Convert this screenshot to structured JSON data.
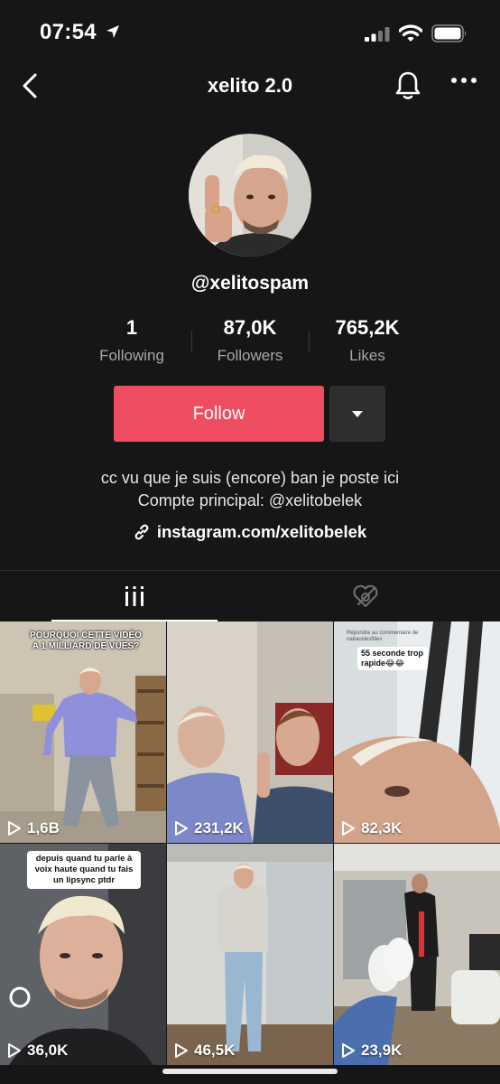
{
  "status_bar": {
    "time": "07:54"
  },
  "header": {
    "title": "xelito 2.0"
  },
  "profile": {
    "username": "@xelitospam",
    "stats": [
      {
        "value": "1",
        "label": "Following"
      },
      {
        "value": "87,0K",
        "label": "Followers"
      },
      {
        "value": "765,2K",
        "label": "Likes"
      }
    ],
    "follow_label": "Follow",
    "bio_line1": "cc vu que je suis (encore) ban je poste ici",
    "bio_line2": "Compte principal: @xelitobelek",
    "link": "instagram.com/xelitobelek"
  },
  "videos": [
    {
      "views": "1,6B",
      "caption": "POURQUOI CETTE VIDÉO A 1 MILLIARD DE VUES?"
    },
    {
      "views": "231,2K"
    },
    {
      "views": "82,3K",
      "caption_small": "Répondre au commentaire de nabauxlesfilles",
      "caption": "55 seconde trop rapide😂😂"
    },
    {
      "views": "36,0K",
      "caption": "depuis quand tu parle à voix haute quand tu fais un lipsync ptdr"
    },
    {
      "views": "46,5K"
    },
    {
      "views": "23,9K"
    }
  ],
  "colors": {
    "accent": "#ef4e62",
    "background": "#161616"
  }
}
